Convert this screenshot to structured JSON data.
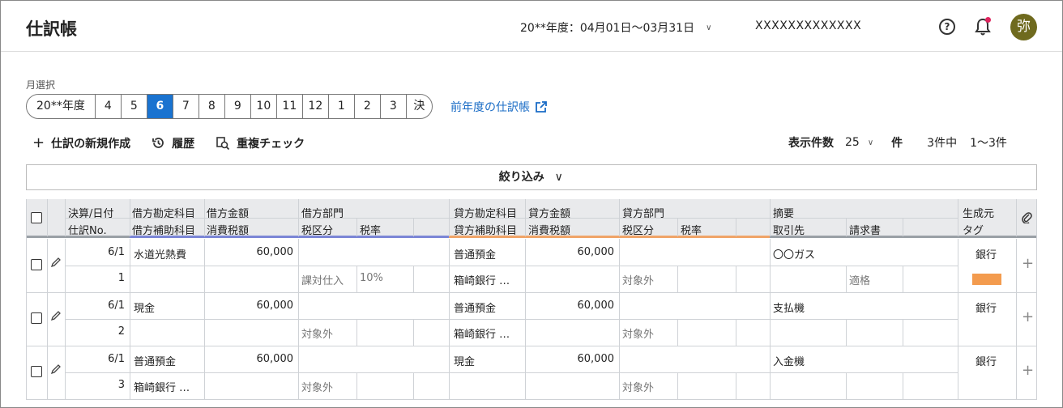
{
  "header": {
    "title": "仕訳帳",
    "fiscal_period": "20**年度：04月01日〜03月31日",
    "company": "XXXXXXXXXXXXX",
    "avatar": "弥"
  },
  "month_select": {
    "label": "月選択",
    "items": [
      "20**年度",
      "4",
      "5",
      "6",
      "7",
      "8",
      "9",
      "10",
      "11",
      "12",
      "1",
      "2",
      "3",
      "決"
    ],
    "active": "6",
    "prev_link": "前年度の仕訳帳"
  },
  "toolbar": {
    "new_entry": "仕訳の新規作成",
    "history": "履歴",
    "duplicate_check": "重複チェック"
  },
  "pager": {
    "display_count_label": "表示件数",
    "display_count_value": "25",
    "unit": "件",
    "total": "3件中",
    "range": "1〜3件"
  },
  "filter": {
    "label": "絞り込み"
  },
  "table": {
    "headers": {
      "date": "決算/日付",
      "entry_no": "仕訳No.",
      "debit_account": "借方勘定科目",
      "debit_sub": "借方補助科目",
      "debit_amount": "借方金額",
      "debit_tax": "消費税額",
      "debit_dept": "借方部門",
      "debit_tax_class": "税区分",
      "debit_tax_rate": "税率",
      "credit_account": "貸方勘定科目",
      "credit_sub": "貸方補助科目",
      "credit_amount": "貸方金額",
      "credit_tax": "消費税額",
      "credit_dept": "貸方部門",
      "credit_tax_class": "税区分",
      "credit_tax_rate": "税率",
      "summary": "摘要",
      "partner": "取引先",
      "invoice": "請求書",
      "source": "生成元",
      "tag": "タグ"
    },
    "rows": [
      {
        "date": "6/1",
        "no": "1",
        "debit_account": "水道光熱費",
        "debit_sub": "",
        "debit_amount": "60,000",
        "debit_tax_class": "課対仕入",
        "debit_tax_rate": "10%",
        "credit_account": "普通預金",
        "credit_sub": "箱崎銀行 …",
        "credit_amount": "60,000",
        "credit_tax_class": "対象外",
        "summary": "〇〇ガス",
        "invoice": "適格",
        "source": "銀行",
        "tag_color": "#f39b4e"
      },
      {
        "date": "6/1",
        "no": "2",
        "debit_account": "現金",
        "debit_sub": "",
        "debit_amount": "60,000",
        "debit_tax_class": "対象外",
        "debit_tax_rate": "",
        "credit_account": "普通預金",
        "credit_sub": "箱崎銀行 …",
        "credit_amount": "60,000",
        "credit_tax_class": "対象外",
        "summary": "支払機",
        "invoice": "",
        "source": "銀行",
        "tag_color": ""
      },
      {
        "date": "6/1",
        "no": "3",
        "debit_account": "普通預金",
        "debit_sub": "箱崎銀行 …",
        "debit_amount": "60,000",
        "debit_tax_class": "対象外",
        "debit_tax_rate": "",
        "credit_account": "現金",
        "credit_sub": "",
        "credit_amount": "60,000",
        "credit_tax_class": "対象外",
        "summary": "入金機",
        "invoice": "",
        "source": "銀行",
        "tag_color": ""
      }
    ]
  },
  "colors": {
    "accent": "#1a73d0",
    "debit_line": "#7b86d6",
    "credit_line": "#f0a468",
    "tag": "#f39b4e"
  }
}
